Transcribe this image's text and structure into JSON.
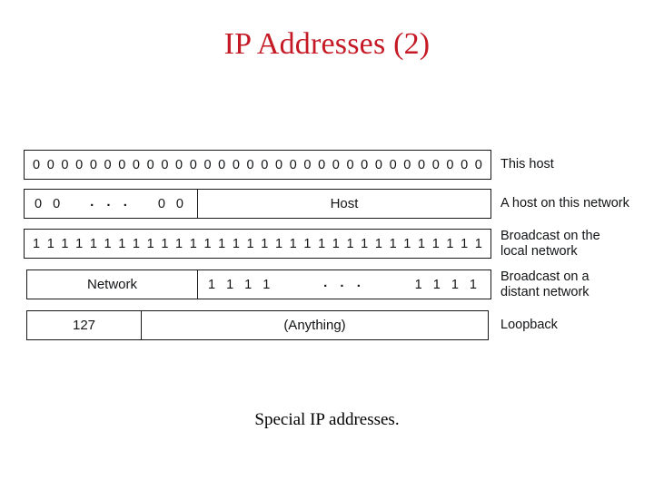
{
  "slide": {
    "title": "IP Addresses (2)",
    "caption": "Special IP addresses.",
    "title_color": "#c51a25",
    "text_color": "#111315",
    "background": "#ffffff"
  },
  "diagram": {
    "bit_width": 32,
    "rows": [
      {
        "id": "this-host",
        "kind": "all-bits",
        "bit": "0",
        "count": 32,
        "description": "This host"
      },
      {
        "id": "host-on-this-network",
        "kind": "split",
        "left": {
          "prefix": "0 0",
          "dots": ". . .",
          "suffix": "0 0"
        },
        "right_label": "Host",
        "description": "A host on this network"
      },
      {
        "id": "broadcast-local",
        "kind": "all-bits",
        "bit": "1",
        "count": 32,
        "description": "Broadcast on the\nlocal network"
      },
      {
        "id": "broadcast-distant",
        "kind": "split",
        "left_label": "Network",
        "right": {
          "prefix": "1 1 1 1",
          "dots": ". . .",
          "suffix": "1 1 1 1"
        },
        "description": "Broadcast on a\ndistant network"
      },
      {
        "id": "loopback",
        "kind": "split",
        "left_label": "127",
        "right_label": "(Anything)",
        "description": "Loopback"
      }
    ]
  }
}
